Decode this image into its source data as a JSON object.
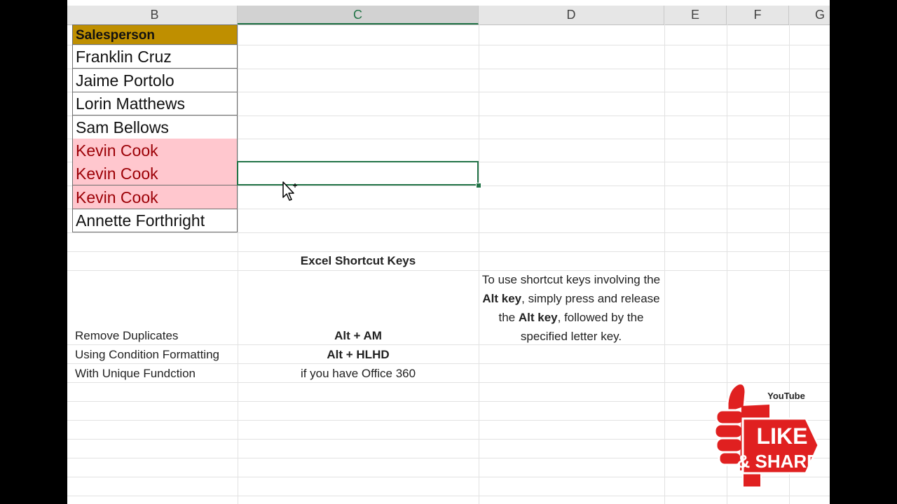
{
  "columns": [
    "B",
    "C",
    "D",
    "E",
    "F",
    "G"
  ],
  "active_column": "C",
  "header_cell": "Salesperson",
  "names": [
    {
      "text": "Franklin Cruz",
      "duplicate": false
    },
    {
      "text": "Jaime Portolo",
      "duplicate": false
    },
    {
      "text": "Lorin Matthews",
      "duplicate": false
    },
    {
      "text": "Sam Bellows",
      "duplicate": false
    },
    {
      "text": "Kevin Cook",
      "duplicate": true
    },
    {
      "text": "Kevin Cook",
      "duplicate": true
    },
    {
      "text": "Kevin Cook",
      "duplicate": true
    },
    {
      "text": "Annette Forthright",
      "duplicate": false
    }
  ],
  "shortcuts": {
    "title": "Excel Shortcut Keys",
    "rows": [
      {
        "label": "Remove Duplicates",
        "keys": "Alt + AM",
        "bold": true
      },
      {
        "label": "Using Condition Formatting",
        "keys": "Alt + HLHD",
        "bold": true
      },
      {
        "label": "With Unique Fundction",
        "keys": "if you have Office 360",
        "bold": false
      }
    ]
  },
  "note": {
    "part1": "To use shortcut keys involving the ",
    "bold1": "Alt key",
    "part2": ", simply press and release the ",
    "bold2": "Alt key",
    "part3": ", followed by the specified letter key."
  },
  "badge": {
    "youtube": "YouTube",
    "like": "LIKE",
    "share": "& SHARE"
  },
  "colors": {
    "header_fill": "#bf8f00",
    "duplicate_fill": "#ffc7ce",
    "duplicate_text": "#9c0006",
    "selection": "#217346",
    "badge_red": "#e02020"
  }
}
